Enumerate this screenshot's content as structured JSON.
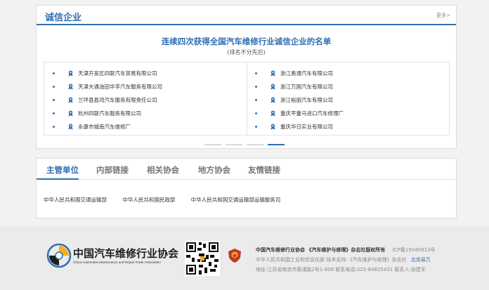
{
  "section1": {
    "title": "诚信企业",
    "more": "更多>",
    "headline": "连续四次获得全国汽车维修行业诚信企业的名单",
    "subline": "(排名不分先后)",
    "left_items": [
      "天津开发区四联汽车贸易有限公司",
      "天津大通油田华孚汽车服务有限公司",
      "兰坪县县鸿汽车服务有限责任公司",
      "杭州四联汽车服务有限公司",
      "永康市城南汽车维修厂"
    ],
    "right_items": [
      "浙江奥通汽车有限公司",
      "浙江万国汽车有限公司",
      "浙江裕丽汽车有限公司",
      "重庆平重马进口汽车修理厂",
      "重庆华日实业有限公司"
    ]
  },
  "section2": {
    "tabs": [
      "主管单位",
      "内部链接",
      "相关协会",
      "地方协会",
      "友情链接"
    ],
    "links": [
      "中华人民共和国交通运输部",
      "中华人民共和国民政部",
      "中华人民共和国交通运输部运输服务司"
    ]
  },
  "footer": {
    "logo_cn": "中国汽车维修行业协会",
    "logo_en": "China Automotive Maintenance and Repair Trade Association",
    "line1_owner": "中国汽车维修行业协会 《汽车维护与修理》杂志社版权所有",
    "line1_icp": "ICP备15040913号",
    "line2_text": "中华人民共和国工业和信息化部   技术支持:《汽车维护与修理》杂志社",
    "line2_link": "北京易万",
    "line3_text": "地址:江苏省南京市黄浦路2号1-808 联系电话:025-84825431 联系人:张建军"
  },
  "colors": {
    "accent": "#2f6fb2",
    "footer_bg": "#ebebeb",
    "page_bg": "#f2f2f2"
  },
  "icons": {
    "list_badge": "award-badge-icon",
    "emblem": "police-emblem-icon",
    "qr": "qr-code-icon"
  }
}
